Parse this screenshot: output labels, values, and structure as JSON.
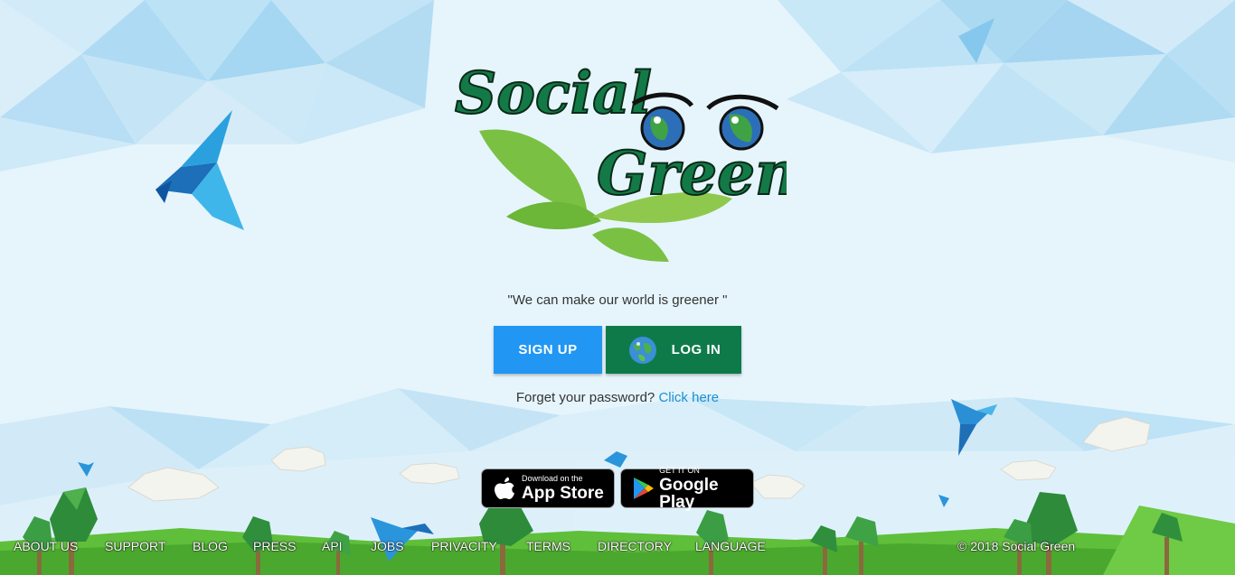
{
  "brand": {
    "logo_line1": "Social",
    "logo_line2": "Green"
  },
  "tagline": "\"We can make our world is greener \"",
  "buttons": {
    "signup": "SIGN UP",
    "login": "LOG IN"
  },
  "forgot": {
    "text": "Forget your password?",
    "link": "Click here"
  },
  "stores": {
    "apple_small": "Download on the",
    "apple_big": "App Store",
    "google_small": "GET IT ON",
    "google_big": "Google Play"
  },
  "footer": {
    "links": [
      "ABOUT US",
      "SUPPORT",
      "BLOG",
      "PRESS",
      "API",
      "JOBS",
      "PRIVACITY",
      "TERMS",
      "DIRECTORY",
      "LANGUAGE"
    ],
    "copyright": "© 2018 Social Green"
  },
  "colors": {
    "signup": "#2196f3",
    "login": "#0e7a4a",
    "link": "#1a8fd0",
    "sky": "#e6f5fc",
    "grass": "#5fbf3a"
  },
  "icons": [
    "globe-icon",
    "apple-icon",
    "google-play-icon",
    "bird-icon",
    "tree-icon",
    "cloud-icon",
    "leaf-icon",
    "eyes-icon"
  ]
}
